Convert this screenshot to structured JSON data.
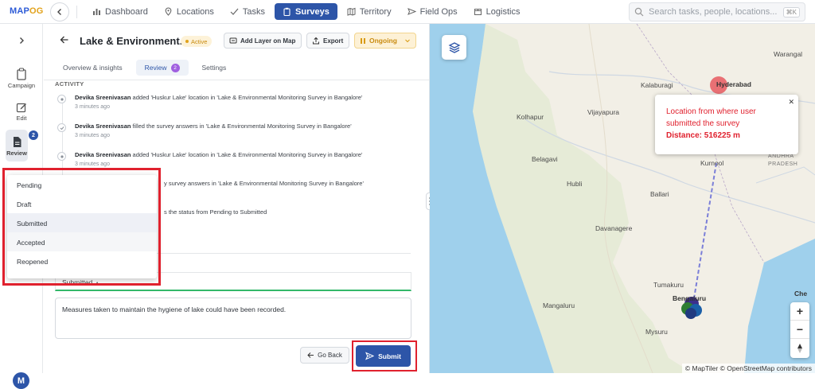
{
  "app": {
    "logo_main": "MAP",
    "logo_accent": "OG"
  },
  "nav": {
    "items": [
      {
        "label": "Dashboard"
      },
      {
        "label": "Locations"
      },
      {
        "label": "Tasks"
      },
      {
        "label": "Surveys"
      },
      {
        "label": "Territory"
      },
      {
        "label": "Field Ops"
      },
      {
        "label": "Logistics"
      }
    ],
    "active": "Surveys"
  },
  "search": {
    "placeholder": "Search tasks, people, locations...",
    "shortcut": "⌘K"
  },
  "rail": {
    "campaign": "Campaign",
    "edit": "Edit",
    "review": "Review",
    "review_badge": "2",
    "avatar": "M"
  },
  "header": {
    "title": "Lake & Environment...",
    "status": "Active",
    "add_layer": "Add Layer on Map",
    "export": "Export",
    "ongoing": "Ongoing"
  },
  "tabs": {
    "overview": "Overview & insights",
    "review": "Review",
    "review_badge": "2",
    "settings": "Settings"
  },
  "activity": {
    "heading": "ACTIVITY",
    "items": [
      {
        "user": "Devika Sreenivasan",
        "text": " added 'Huskur Lake' location in 'Lake & Environmental Monitoring Survey in Bangalore'",
        "time": "3 minutes ago"
      },
      {
        "user": "Devika Sreenivasan",
        "text": " filled the survey answers in 'Lake & Environmental Monitoring Survey in Bangalore'",
        "time": "3 minutes ago"
      },
      {
        "user": "Devika Sreenivasan",
        "text": " added 'Huskur Lake' location in 'Lake & Environmental Monitoring Survey in Bangalore'",
        "time": "3 minutes ago"
      },
      {
        "user": "",
        "text": "y survey answers in 'Lake & Environmental Monitoring Survey in Bangalore'",
        "time": ""
      },
      {
        "user": "",
        "text": "s the status from Pending to Submitted",
        "time": ""
      }
    ]
  },
  "status_dropdown": {
    "value": "Submitted",
    "options": [
      "Pending",
      "Draft",
      "Submitted",
      "Accepted",
      "Reopened"
    ]
  },
  "comment": {
    "value": "Measures taken to maintain the hygiene of lake could have been recorded."
  },
  "actions": {
    "go_back": "Go Back",
    "submit": "Submit"
  },
  "map": {
    "labels": {
      "kolhapur": "Kolhapur",
      "vijayapura": "Vijayapura",
      "kalaburagi": "Kalaburagi",
      "hyderabad": "Hyderabad",
      "warangal": "Warangal",
      "belagavi": "Belagavi",
      "hubli": "Hubli",
      "ballari": "Ballari",
      "kurnool": "Kurnool",
      "davanagere": "Davanagere",
      "tumakuru": "Tumakuru",
      "mangaluru": "Mangaluru",
      "bengaluru": "Bengaluru",
      "mysuru": "Mysuru",
      "chennai": "Che",
      "andhra1": "ANDHRA",
      "andhra2": "PRADESH"
    },
    "popup": {
      "line1": "Location from where user",
      "line2": "submitted the survey",
      "distance": "Distance: 516225 m"
    },
    "zoom_in": "+",
    "zoom_out": "−",
    "attribution": "© MapTiler © OpenStreetMap contributors"
  },
  "colors": {
    "primary": "#2d55a8",
    "highlight": "#e0212e",
    "active": "#e0a21b",
    "accent_green": "#33b86a"
  }
}
